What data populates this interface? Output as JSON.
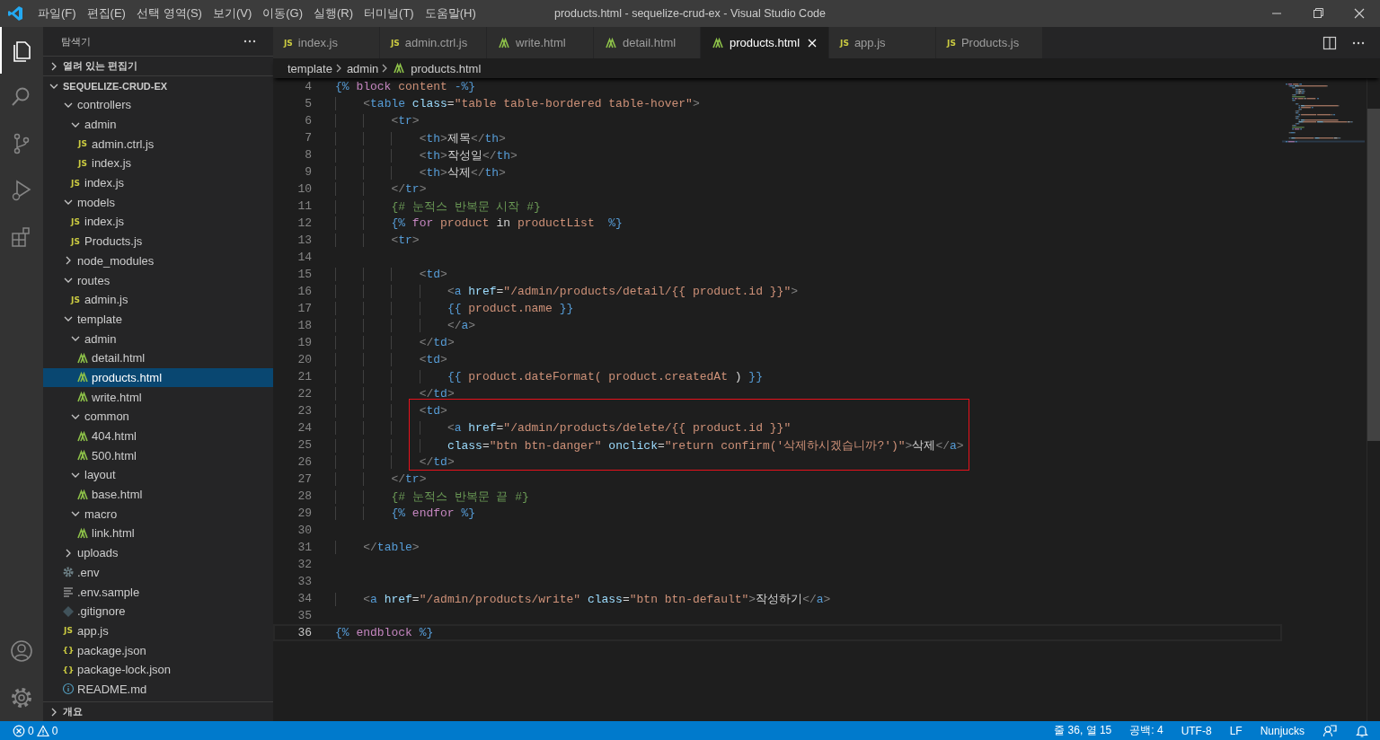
{
  "title_bar": {
    "menu": [
      "파일(F)",
      "편집(E)",
      "선택 영역(S)",
      "보기(V)",
      "이동(G)",
      "실행(R)",
      "터미널(T)",
      "도움말(H)"
    ],
    "title": "products.html - sequelize-crud-ex - Visual Studio Code"
  },
  "activity_bar": {
    "items": [
      {
        "kind": "explorer",
        "selected": true
      },
      {
        "kind": "search",
        "selected": false
      },
      {
        "kind": "source-control",
        "selected": false
      },
      {
        "kind": "run",
        "selected": false
      },
      {
        "kind": "extensions",
        "selected": false
      }
    ],
    "bottom": [
      {
        "kind": "account"
      },
      {
        "kind": "settings"
      }
    ]
  },
  "sidebar": {
    "title": "탐색기",
    "sections": [
      {
        "title": "열려 있는 편집기",
        "expanded": false
      },
      {
        "title": "SEQUELIZE-CRUD-EX",
        "expanded": true,
        "tree": [
          {
            "label": "controllers",
            "kind": "folder",
            "expanded": true,
            "selected": false,
            "children": [
              {
                "label": "admin",
                "kind": "folder",
                "expanded": true,
                "selected": false,
                "children": [
                  {
                    "label": "admin.ctrl.js",
                    "kind": "js",
                    "icon_text": "JS",
                    "selected": false
                  },
                  {
                    "label": "index.js",
                    "kind": "js",
                    "icon_text": "JS",
                    "selected": false
                  }
                ]
              },
              {
                "label": "index.js",
                "kind": "js",
                "icon_text": "JS",
                "selected": false
              }
            ]
          },
          {
            "label": "models",
            "kind": "folder",
            "expanded": true,
            "selected": false,
            "children": [
              {
                "label": "index.js",
                "kind": "js",
                "icon_text": "JS",
                "selected": false
              },
              {
                "label": "Products.js",
                "kind": "js",
                "icon_text": "JS",
                "selected": false
              }
            ]
          },
          {
            "label": "node_modules",
            "kind": "folder",
            "expanded": false,
            "selected": false
          },
          {
            "label": "routes",
            "kind": "folder",
            "expanded": true,
            "selected": false,
            "children": [
              {
                "label": "admin.js",
                "kind": "js",
                "icon_text": "JS",
                "selected": false
              }
            ]
          },
          {
            "label": "template",
            "kind": "folder",
            "expanded": true,
            "selected": false,
            "children": [
              {
                "label": "admin",
                "kind": "folder",
                "expanded": true,
                "selected": false,
                "children": [
                  {
                    "label": "detail.html",
                    "kind": "html",
                    "selected": false
                  },
                  {
                    "label": "products.html",
                    "kind": "html",
                    "selected": true
                  },
                  {
                    "label": "write.html",
                    "kind": "html",
                    "selected": false
                  }
                ]
              },
              {
                "label": "common",
                "kind": "folder",
                "expanded": true,
                "selected": false,
                "children": [
                  {
                    "label": "404.html",
                    "kind": "html",
                    "selected": false
                  },
                  {
                    "label": "500.html",
                    "kind": "html",
                    "selected": false
                  }
                ]
              },
              {
                "label": "layout",
                "kind": "folder",
                "expanded": true,
                "selected": false,
                "children": [
                  {
                    "label": "base.html",
                    "kind": "html",
                    "selected": false
                  }
                ]
              },
              {
                "label": "macro",
                "kind": "folder",
                "expanded": true,
                "selected": false,
                "children": [
                  {
                    "label": "link.html",
                    "kind": "html",
                    "selected": false
                  }
                ]
              }
            ]
          },
          {
            "label": "uploads",
            "kind": "folder",
            "expanded": false,
            "selected": false
          },
          {
            "label": ".env",
            "kind": "config",
            "selected": false
          },
          {
            "label": ".env.sample",
            "kind": "text",
            "selected": false
          },
          {
            "label": ".gitignore",
            "kind": "git",
            "selected": false
          },
          {
            "label": "app.js",
            "kind": "js",
            "icon_text": "JS",
            "selected": false
          },
          {
            "label": "package.json",
            "kind": "json",
            "icon_text": "{}",
            "selected": false
          },
          {
            "label": "package-lock.json",
            "kind": "json",
            "icon_text": "{}",
            "selected": false
          },
          {
            "label": "README.md",
            "kind": "info",
            "selected": false
          }
        ]
      },
      {
        "title": "개요",
        "expanded": false
      }
    ]
  },
  "tabs": [
    {
      "label": "index.js",
      "kind": "js",
      "icon_text": "JS",
      "selected": false
    },
    {
      "label": "admin.ctrl.js",
      "kind": "js",
      "icon_text": "JS",
      "selected": false
    },
    {
      "label": "write.html",
      "kind": "html",
      "selected": false
    },
    {
      "label": "detail.html",
      "kind": "html",
      "selected": false
    },
    {
      "label": "products.html",
      "kind": "html",
      "selected": true
    },
    {
      "label": "app.js",
      "kind": "js",
      "icon_text": "JS",
      "selected": false
    },
    {
      "label": "Products.js",
      "kind": "js",
      "icon_text": "JS",
      "selected": false
    }
  ],
  "breadcrumb": [
    {
      "label": "template",
      "kind": "folder"
    },
    {
      "label": "admin",
      "kind": "folder"
    },
    {
      "label": "products.html",
      "kind": "html"
    }
  ],
  "editor": {
    "lines": [
      {
        "number": "4",
        "marked": false,
        "current": false,
        "tokens": [
          {
            "text": "{%",
            "kind": "d"
          },
          {
            "text": " block",
            "kind": "kw"
          },
          {
            "text": " content",
            "kind": "var"
          },
          {
            "text": " -%}",
            "kind": "d"
          }
        ]
      },
      {
        "number": "5",
        "marked": false,
        "current": false,
        "tokens": [
          {
            "text": "    <",
            "kind": "p"
          },
          {
            "text": "table",
            "kind": "tag"
          },
          {
            "text": " class",
            "kind": "attr"
          },
          {
            "text": "=",
            "kind": "txt"
          },
          {
            "text": "\"table table-bordered table-hover\"",
            "kind": "str"
          },
          {
            "text": ">",
            "kind": "p"
          }
        ]
      },
      {
        "number": "6",
        "marked": false,
        "current": false,
        "tokens": [
          {
            "text": "        <",
            "kind": "p"
          },
          {
            "text": "tr",
            "kind": "tag"
          },
          {
            "text": ">",
            "kind": "p"
          }
        ]
      },
      {
        "number": "7",
        "marked": false,
        "current": false,
        "tokens": [
          {
            "text": "            <",
            "kind": "p"
          },
          {
            "text": "th",
            "kind": "tag"
          },
          {
            "text": ">",
            "kind": "p"
          },
          {
            "text": "제목",
            "kind": "txt"
          },
          {
            "text": "</",
            "kind": "p"
          },
          {
            "text": "th",
            "kind": "tag"
          },
          {
            "text": ">",
            "kind": "p"
          }
        ]
      },
      {
        "number": "8",
        "marked": false,
        "current": false,
        "tokens": [
          {
            "text": "            <",
            "kind": "p"
          },
          {
            "text": "th",
            "kind": "tag"
          },
          {
            "text": ">",
            "kind": "p"
          },
          {
            "text": "작성일",
            "kind": "txt"
          },
          {
            "text": "</",
            "kind": "p"
          },
          {
            "text": "th",
            "kind": "tag"
          },
          {
            "text": ">",
            "kind": "p"
          }
        ]
      },
      {
        "number": "9",
        "marked": false,
        "current": false,
        "tokens": [
          {
            "text": "            <",
            "kind": "p"
          },
          {
            "text": "th",
            "kind": "tag"
          },
          {
            "text": ">",
            "kind": "p"
          },
          {
            "text": "삭제",
            "kind": "txt"
          },
          {
            "text": "</",
            "kind": "p"
          },
          {
            "text": "th",
            "kind": "tag"
          },
          {
            "text": ">",
            "kind": "p"
          }
        ]
      },
      {
        "number": "10",
        "marked": false,
        "current": false,
        "tokens": [
          {
            "text": "        </",
            "kind": "p"
          },
          {
            "text": "tr",
            "kind": "tag"
          },
          {
            "text": ">",
            "kind": "p"
          }
        ]
      },
      {
        "number": "11",
        "marked": false,
        "current": false,
        "tokens": [
          {
            "text": "        {# 눈적스 반복문 시작 #}",
            "kind": "cm"
          }
        ]
      },
      {
        "number": "12",
        "marked": false,
        "current": false,
        "tokens": [
          {
            "text": "        {%",
            "kind": "d"
          },
          {
            "text": " for",
            "kind": "kw"
          },
          {
            "text": " product",
            "kind": "var"
          },
          {
            "text": " in",
            "kind": "txt"
          },
          {
            "text": " productList",
            "kind": "var"
          },
          {
            "text": "  %}",
            "kind": "d"
          }
        ]
      },
      {
        "number": "13",
        "marked": false,
        "current": false,
        "tokens": [
          {
            "text": "        <",
            "kind": "p"
          },
          {
            "text": "tr",
            "kind": "tag"
          },
          {
            "text": ">",
            "kind": "p"
          }
        ]
      },
      {
        "number": "14",
        "marked": false,
        "current": false
      },
      {
        "number": "15",
        "marked": false,
        "current": false,
        "tokens": [
          {
            "text": "            <",
            "kind": "p"
          },
          {
            "text": "td",
            "kind": "tag"
          },
          {
            "text": ">",
            "kind": "p"
          }
        ]
      },
      {
        "number": "16",
        "marked": false,
        "current": false,
        "tokens": [
          {
            "text": "                <",
            "kind": "p"
          },
          {
            "text": "a",
            "kind": "tag"
          },
          {
            "text": " href",
            "kind": "attr"
          },
          {
            "text": "=",
            "kind": "txt"
          },
          {
            "text": "\"/admin/products/detail/{{ product.id }}\"",
            "kind": "str"
          },
          {
            "text": ">",
            "kind": "p"
          }
        ]
      },
      {
        "number": "17",
        "marked": false,
        "current": false,
        "tokens": [
          {
            "text": "                {{",
            "kind": "d"
          },
          {
            "text": " product.name",
            "kind": "var"
          },
          {
            "text": " }}",
            "kind": "d"
          }
        ]
      },
      {
        "number": "18",
        "marked": false,
        "current": false,
        "tokens": [
          {
            "text": "                </",
            "kind": "p"
          },
          {
            "text": "a",
            "kind": "tag"
          },
          {
            "text": ">",
            "kind": "p"
          }
        ]
      },
      {
        "number": "19",
        "marked": false,
        "current": false,
        "tokens": [
          {
            "text": "            </",
            "kind": "p"
          },
          {
            "text": "td",
            "kind": "tag"
          },
          {
            "text": ">",
            "kind": "p"
          }
        ]
      },
      {
        "number": "20",
        "marked": false,
        "current": false,
        "tokens": [
          {
            "text": "            <",
            "kind": "p"
          },
          {
            "text": "td",
            "kind": "tag"
          },
          {
            "text": ">",
            "kind": "p"
          }
        ]
      },
      {
        "number": "21",
        "marked": false,
        "current": false,
        "tokens": [
          {
            "text": "                {{",
            "kind": "d"
          },
          {
            "text": " product.dateFormat(",
            "kind": "var"
          },
          {
            "text": " product.createdAt",
            "kind": "var"
          },
          {
            "text": " )",
            "kind": "txt"
          },
          {
            "text": " }}",
            "kind": "d"
          }
        ]
      },
      {
        "number": "22",
        "marked": false,
        "current": false,
        "tokens": [
          {
            "text": "            </",
            "kind": "p"
          },
          {
            "text": "td",
            "kind": "tag"
          },
          {
            "text": ">",
            "kind": "p"
          }
        ]
      },
      {
        "number": "23",
        "marked": true,
        "current": false,
        "tokens": [
          {
            "text": "            <",
            "kind": "p"
          },
          {
            "text": "td",
            "kind": "tag"
          },
          {
            "text": ">",
            "kind": "p"
          }
        ]
      },
      {
        "number": "24",
        "marked": true,
        "current": false,
        "tokens": [
          {
            "text": "                <",
            "kind": "p"
          },
          {
            "text": "a",
            "kind": "tag"
          },
          {
            "text": " href",
            "kind": "attr"
          },
          {
            "text": "=",
            "kind": "txt"
          },
          {
            "text": "\"/admin/products/delete/{{ product.id }}\"",
            "kind": "str"
          }
        ]
      },
      {
        "number": "25",
        "marked": true,
        "current": false,
        "tokens": [
          {
            "text": "                class",
            "kind": "attr"
          },
          {
            "text": "=",
            "kind": "txt"
          },
          {
            "text": "\"btn btn-danger\"",
            "kind": "str"
          },
          {
            "text": " onclick",
            "kind": "attr"
          },
          {
            "text": "=",
            "kind": "txt"
          },
          {
            "text": "\"return confirm('삭제하시겠습니까?')\"",
            "kind": "str"
          },
          {
            "text": ">",
            "kind": "p"
          },
          {
            "text": "삭제",
            "kind": "txt"
          },
          {
            "text": "</",
            "kind": "p"
          },
          {
            "text": "a",
            "kind": "tag"
          },
          {
            "text": ">",
            "kind": "p"
          }
        ]
      },
      {
        "number": "26",
        "marked": true,
        "current": false,
        "tokens": [
          {
            "text": "            </",
            "kind": "p"
          },
          {
            "text": "td",
            "kind": "tag"
          },
          {
            "text": ">",
            "kind": "p"
          }
        ]
      },
      {
        "number": "27",
        "marked": false,
        "current": false,
        "tokens": [
          {
            "text": "        </",
            "kind": "p"
          },
          {
            "text": "tr",
            "kind": "tag"
          },
          {
            "text": ">",
            "kind": "p"
          }
        ]
      },
      {
        "number": "28",
        "marked": false,
        "current": false,
        "tokens": [
          {
            "text": "        {# 눈적스 반복문 끝 #}",
            "kind": "cm"
          }
        ]
      },
      {
        "number": "29",
        "marked": false,
        "current": false,
        "tokens": [
          {
            "text": "        {%",
            "kind": "d"
          },
          {
            "text": " endfor",
            "kind": "kw"
          },
          {
            "text": " %}",
            "kind": "d"
          }
        ]
      },
      {
        "number": "30",
        "marked": false,
        "current": false
      },
      {
        "number": "31",
        "marked": false,
        "current": false,
        "tokens": [
          {
            "text": "    </",
            "kind": "p"
          },
          {
            "text": "table",
            "kind": "tag"
          },
          {
            "text": ">",
            "kind": "p"
          }
        ]
      },
      {
        "number": "32",
        "marked": false,
        "current": false
      },
      {
        "number": "33",
        "marked": false,
        "current": false
      },
      {
        "number": "34",
        "marked": false,
        "current": false,
        "tokens": [
          {
            "text": "    <",
            "kind": "p"
          },
          {
            "text": "a",
            "kind": "tag"
          },
          {
            "text": " href",
            "kind": "attr"
          },
          {
            "text": "=",
            "kind": "txt"
          },
          {
            "text": "\"/admin/products/write\"",
            "kind": "str"
          },
          {
            "text": " class",
            "kind": "attr"
          },
          {
            "text": "=",
            "kind": "txt"
          },
          {
            "text": "\"btn btn-default\"",
            "kind": "str"
          },
          {
            "text": ">",
            "kind": "p"
          },
          {
            "text": "작성하기",
            "kind": "txt"
          },
          {
            "text": "</",
            "kind": "p"
          },
          {
            "text": "a",
            "kind": "tag"
          },
          {
            "text": ">",
            "kind": "p"
          }
        ]
      },
      {
        "number": "35",
        "marked": false,
        "current": false
      },
      {
        "number": "36",
        "marked": false,
        "current": true,
        "tokens": [
          {
            "text": "{%",
            "kind": "d"
          },
          {
            "text": " endblock",
            "kind": "kw"
          },
          {
            "text": " %}",
            "kind": "d"
          }
        ]
      }
    ]
  },
  "status_bar": {
    "left": [
      {
        "kind": "errors",
        "text": "0"
      },
      {
        "kind": "warnings",
        "text": "0"
      }
    ],
    "right": [
      {
        "kind": "text",
        "text": "줄 36, 열 15"
      },
      {
        "kind": "text",
        "text": "공백: 4"
      },
      {
        "kind": "text",
        "text": "UTF-8"
      },
      {
        "kind": "text",
        "text": "LF"
      },
      {
        "kind": "text",
        "text": "Nunjucks"
      },
      {
        "kind": "feedback"
      },
      {
        "kind": "notifications"
      }
    ]
  }
}
